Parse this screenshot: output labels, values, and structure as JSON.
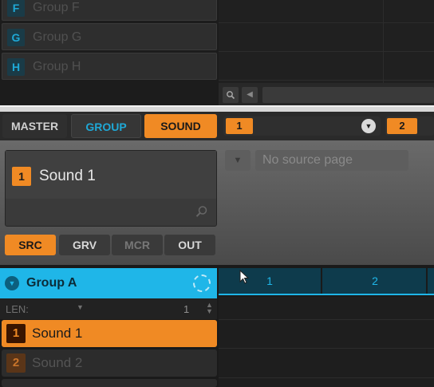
{
  "groups": [
    {
      "letter": "F",
      "name": "Group F"
    },
    {
      "letter": "G",
      "name": "Group G"
    },
    {
      "letter": "H",
      "name": "Group H"
    }
  ],
  "tabs": {
    "master": "MASTER",
    "group": "GROUP",
    "sound": "SOUND",
    "slot1": "1",
    "slot2": "2"
  },
  "sound_box": {
    "number": "1",
    "name": "Sound 1"
  },
  "source": {
    "placeholder": "No source page"
  },
  "subtabs": {
    "src": "SRC",
    "grv": "GRV",
    "mcr": "MCR",
    "out": "OUT"
  },
  "group_header": {
    "name": "Group A"
  },
  "timeline": {
    "bars": [
      "1",
      "2"
    ]
  },
  "length": {
    "label": "LEN:",
    "value": "1"
  },
  "sounds": [
    {
      "number": "1",
      "name": "Sound 1"
    },
    {
      "number": "2",
      "name": "Sound 2"
    }
  ],
  "colors": {
    "accent_orange": "#f08a24",
    "accent_blue": "#1fb6e8"
  },
  "icons": {
    "zoom": "magnifier-icon",
    "scroll_left": "arrow-left-icon",
    "dropdown": "chevron-down-icon",
    "search": "search-icon",
    "collapse": "collapse-icon",
    "dial": "dial-icon",
    "cursor": "mouse-pointer-icon"
  }
}
